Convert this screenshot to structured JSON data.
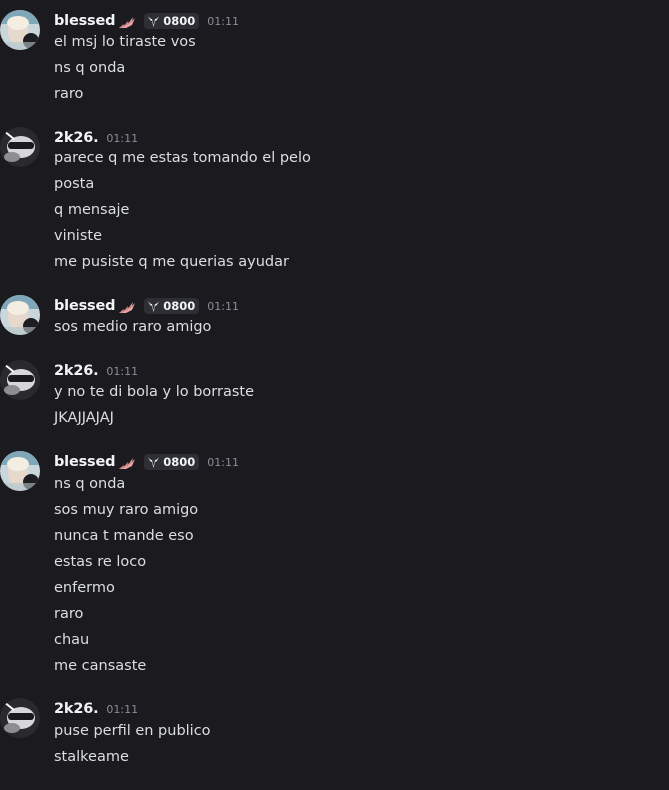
{
  "users": {
    "blessed": {
      "name": "blessed",
      "clan_tag": "0800",
      "badge": "pink-wings-decoration",
      "clan_icon": "ram-skull-icon"
    },
    "k26": {
      "name": "2k26."
    }
  },
  "colors": {
    "background": "#1b1b1f",
    "username": "#f2f3f5",
    "message_text": "#dbdee1",
    "timestamp": "#8b8e95",
    "clan_tag_bg": "#2e2f35"
  },
  "groups": [
    {
      "user": "blessed",
      "time": "01:11",
      "messages": [
        "el msj lo tiraste vos",
        "ns q onda",
        "raro"
      ]
    },
    {
      "user": "k26",
      "time": "01:11",
      "messages": [
        "parece q me estas tomando el pelo",
        "posta",
        "q mensaje",
        "viniste",
        "me pusiste q me querias ayudar"
      ]
    },
    {
      "user": "blessed",
      "time": "01:11",
      "messages": [
        "sos medio raro amigo"
      ]
    },
    {
      "user": "k26",
      "time": "01:11",
      "messages": [
        "y no te di bola y lo borraste",
        "JKAJJAJAJ"
      ]
    },
    {
      "user": "blessed",
      "time": "01:11",
      "messages": [
        "ns q onda",
        "sos muy raro amigo",
        "nunca t mande eso",
        "estas re loco",
        "enfermo",
        "raro",
        "chau",
        "me cansaste"
      ]
    },
    {
      "user": "k26",
      "time": "01:11",
      "messages": [
        "puse perfil en publico",
        "stalkeame"
      ]
    }
  ]
}
